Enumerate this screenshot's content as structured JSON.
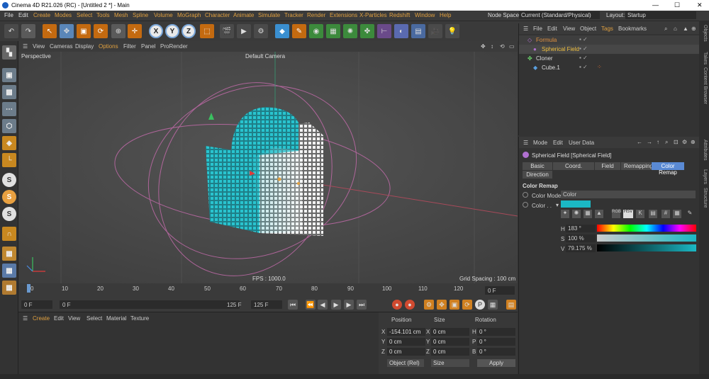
{
  "window": {
    "title": "Cinema 4D R21.026 (RC) - [Untitled 2 *] - Main"
  },
  "menu": {
    "items": [
      "File",
      "Edit",
      "Create",
      "Modes",
      "Select",
      "Tools",
      "Mesh",
      "Spline",
      "Volume",
      "MoGraph",
      "Character",
      "Animate",
      "Simulate",
      "Tracker",
      "Render",
      "Extensions",
      "X-Particles",
      "Redshift",
      "Window",
      "Help"
    ],
    "node_space_label": "Node Space:",
    "node_space_value": "Current (Standard/Physical)",
    "layout_label": "Layout:",
    "layout_value": "Startup"
  },
  "viewport": {
    "menu": [
      "View",
      "Cameras",
      "Display",
      "Options",
      "Filter",
      "Panel",
      "ProRender"
    ],
    "name": "Perspective",
    "camera": "Default Camera",
    "fps": "FPS : 1000.0",
    "grid": "Grid Spacing : 100 cm"
  },
  "timeline": {
    "ticks": [
      "0",
      "10",
      "20",
      "30",
      "40",
      "50",
      "60",
      "70",
      "80",
      "90",
      "100",
      "110",
      "120"
    ],
    "current": "0 F"
  },
  "transport": {
    "start": "0 F",
    "preview_start": "0 F",
    "preview_end": "125 F",
    "end": "125 F"
  },
  "materials": {
    "menu": [
      "Create",
      "Edit",
      "View",
      "Select",
      "Material",
      "Texture"
    ]
  },
  "coords": {
    "headers": [
      "Position",
      "Size",
      "Rotation"
    ],
    "pos": [
      "-154.101 cm",
      "0 cm",
      "0 cm"
    ],
    "size": [
      "0 cm",
      "0 cm",
      "0 cm"
    ],
    "rot": [
      "0 °",
      "0 °",
      "0 °"
    ],
    "axes": [
      "X",
      "Y",
      "Z"
    ],
    "rot_axes": [
      "H",
      "P",
      "B"
    ],
    "mode": "Object (Rel)",
    "size_mode": "Size",
    "apply": "Apply"
  },
  "objects": {
    "menu": [
      "File",
      "Edit",
      "View",
      "Object",
      "Tags",
      "Bookmarks"
    ],
    "items": [
      "Formula",
      "Spherical Field",
      "Cloner",
      "Cube.1"
    ]
  },
  "attributes": {
    "menu": [
      "Mode",
      "Edit",
      "User Data"
    ],
    "object": "Spherical Field [Spherical Field]",
    "tabs": [
      "Basic",
      "Coord.",
      "Field",
      "Remapping",
      "Color Remap"
    ],
    "tab2": "Direction",
    "section": "Color Remap",
    "color_mode_label": "Color Mode",
    "color_mode_value": "Color",
    "color_label": "Color . .",
    "h_label": "H",
    "h_value": "183 °",
    "s_label": "S",
    "s_value": "100 %",
    "v_label": "V",
    "v_value": "79.175 %",
    "swatch": "#1bb8c4"
  },
  "side_tabs": [
    "Objects",
    "Takes",
    "Content Browser",
    "Attributes",
    "Layers",
    "Structure"
  ]
}
